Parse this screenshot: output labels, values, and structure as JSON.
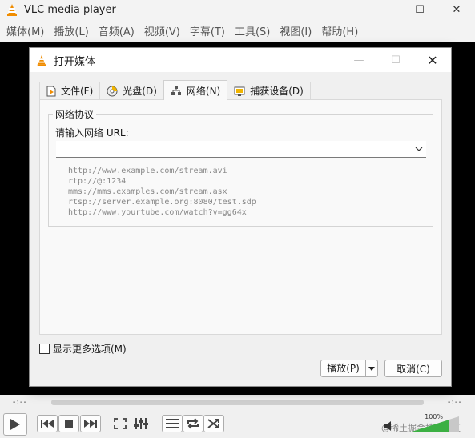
{
  "app": {
    "title": "VLC media player",
    "icon": "vlc-cone-icon"
  },
  "window_controls": {
    "minimize": "—",
    "maximize": "☐",
    "close": "✕"
  },
  "menubar": {
    "items": [
      {
        "label": "媒体(M)"
      },
      {
        "label": "播放(L)"
      },
      {
        "label": "音频(A)"
      },
      {
        "label": "视频(V)"
      },
      {
        "label": "字幕(T)"
      },
      {
        "label": "工具(S)"
      },
      {
        "label": "视图(I)"
      },
      {
        "label": "帮助(H)"
      }
    ]
  },
  "dialog": {
    "title": "打开媒体",
    "controls": {
      "minimize": "—",
      "maximize": "☐",
      "close": "✕"
    },
    "tabs": [
      {
        "label": "文件(F)",
        "icon": "file-icon",
        "active": false
      },
      {
        "label": "光盘(D)",
        "icon": "disc-icon",
        "active": false
      },
      {
        "label": "网络(N)",
        "icon": "network-icon",
        "active": true
      },
      {
        "label": "捕获设备(D)",
        "icon": "capture-device-icon",
        "active": false
      }
    ],
    "network": {
      "group_title": "网络协议",
      "url_label": "请输入网络 URL:",
      "url_value": "",
      "examples": [
        "http://www.example.com/stream.avi",
        "rtp://@:1234",
        "mms://mms.examples.com/stream.asx",
        "rtsp://server.example.org:8080/test.sdp",
        "http://www.yourtube.com/watch?v=gg64x"
      ]
    },
    "more_options": {
      "label": "显示更多选项(M)",
      "checked": false
    },
    "play_button": "播放(P)",
    "cancel_button": "取消(C)"
  },
  "player": {
    "time_elapsed": "-:--",
    "time_total": "-:--",
    "volume_percent": "100%",
    "watermark": "@稀土掘金技术社区"
  },
  "colors": {
    "vlc_orange": "#f08c00",
    "volume_green": "#3cb043",
    "accent": "#0078d7"
  }
}
